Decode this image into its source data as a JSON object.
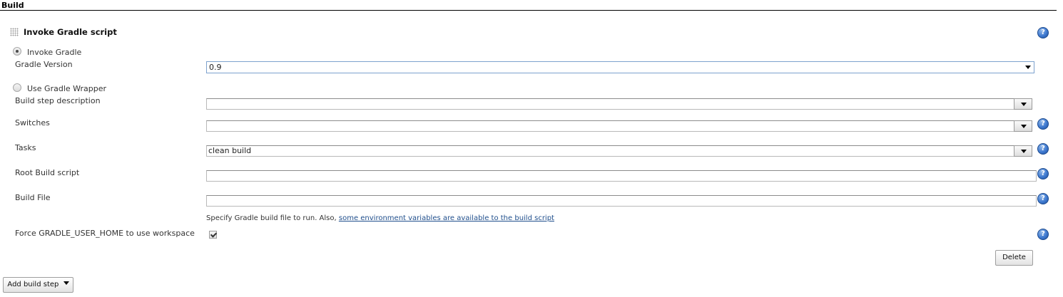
{
  "section": {
    "title": "Build"
  },
  "step": {
    "title": "Invoke Gradle script",
    "invoke_gradle_label": "Invoke Gradle",
    "gradle_version_label": "Gradle Version",
    "gradle_version_value": "0.9",
    "use_wrapper_label": "Use Gradle Wrapper",
    "description_label": "Build step description",
    "description_value": "",
    "switches_label": "Switches",
    "switches_value": "",
    "tasks_label": "Tasks",
    "tasks_value": "clean build",
    "root_script_label": "Root Build script",
    "root_script_value": "",
    "build_file_label": "Build File",
    "build_file_value": "",
    "build_file_hint": "Specify Gradle build file to run. Also,",
    "build_file_link": "some environment variables are available to the build script",
    "force_home_label": "Force GRADLE_USER_HOME to use workspace",
    "delete_label": "Delete"
  },
  "footer": {
    "add_step_label": "Add build step"
  },
  "icons": {
    "help": "help-icon",
    "drag": "drag-handle-icon",
    "dropdown": "caret-down-icon"
  },
  "colors": {
    "link": "#1f4e8c",
    "help_icon": "#3f7ad0",
    "focus_border": "#7da2ce"
  }
}
